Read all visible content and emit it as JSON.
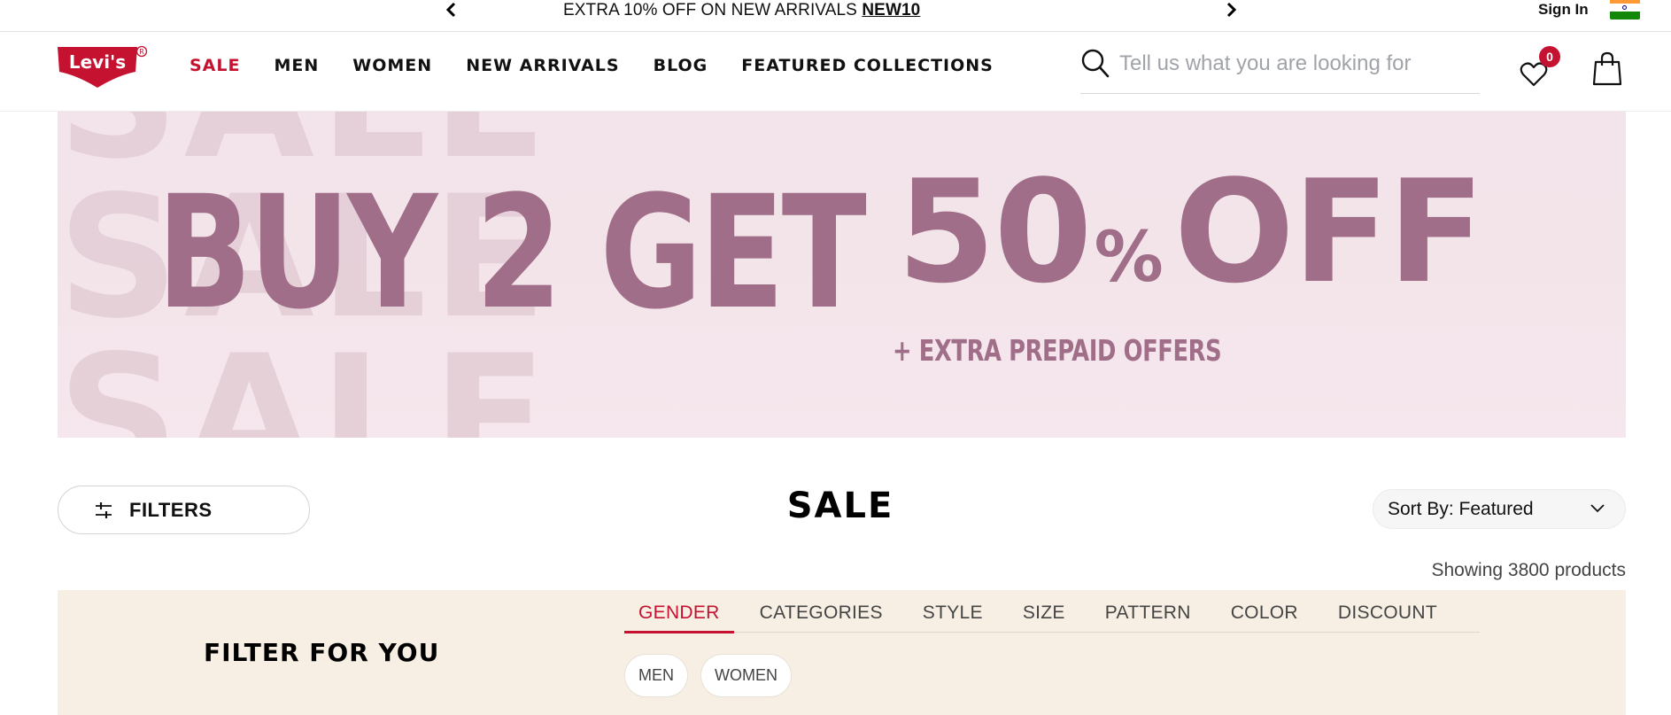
{
  "promo": {
    "message": "EXTRA 10% OFF ON NEW ARRIVALS ",
    "code": "NEW10",
    "prev_icon": "chevron-left-icon",
    "next_icon": "chevron-right-icon",
    "sign_in": "Sign In",
    "flag_icon": "india-flag-icon"
  },
  "header": {
    "logo_text": "Levi's",
    "nav": [
      "SALE",
      "MEN",
      "WOMEN",
      "NEW ARRIVALS",
      "BLOG",
      "FEATURED COLLECTIONS"
    ],
    "search_placeholder": "Tell us what you are looking for",
    "wishlist_count": "0",
    "brand_red": "#c41230"
  },
  "hero": {
    "ghost_word": "SALE",
    "line1": "BUY 2 GET",
    "number": "50",
    "percent": "%",
    "off": "OFF",
    "line3": "+ EXTRA PREPAID OFFERS",
    "text_color": "#a06e88"
  },
  "toolbar": {
    "filters_label": "FILTERS",
    "page_title": "SALE",
    "sort_label": "Sort By: Featured",
    "showing": "Showing 3800 products"
  },
  "filter_for_you": {
    "heading": "FILTER FOR YOU",
    "tabs": [
      "GENDER",
      "CATEGORIES",
      "STYLE",
      "SIZE",
      "PATTERN",
      "COLOR",
      "DISCOUNT"
    ],
    "active_tab": "GENDER",
    "chips": [
      "MEN",
      "WOMEN"
    ],
    "background": "#f7efe4"
  }
}
